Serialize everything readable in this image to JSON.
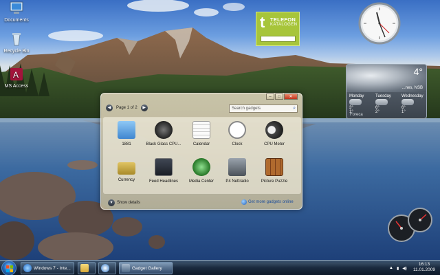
{
  "desktop": {
    "icons": [
      {
        "label": "Documents",
        "icon": "computer-icon"
      },
      {
        "label": "Recycle Bin",
        "icon": "recycle-bin-icon"
      },
      {
        "label": "MS Access",
        "icon": "ms-access-icon"
      }
    ]
  },
  "telefon_gadget": {
    "line1": "TELEFON",
    "line2": "KATALOGEN",
    "letter": "t",
    "search_value": ""
  },
  "weather_gadget": {
    "temp": "4°",
    "location": "...nes, NSB",
    "days": [
      {
        "name": "Monday",
        "hi": "3°",
        "lo": "1°"
      },
      {
        "name": "Tuesday",
        "hi": "6°",
        "lo": "2°"
      },
      {
        "name": "Wednesday",
        "hi": "6°",
        "lo": "1°"
      }
    ],
    "source": "Foreca"
  },
  "gadget_gallery": {
    "page_label": "Page 1 of 2",
    "search_placeholder": "Search gadgets",
    "show_details": "Show details",
    "get_more": "Get more gadgets online",
    "items": [
      {
        "name": "1881",
        "icon": "1881-icon",
        "color": "#5aa0e0"
      },
      {
        "name": "Black Glass CPU...",
        "icon": "cpu-meter-icon",
        "color": "#2b2b2b"
      },
      {
        "name": "Calendar",
        "icon": "calendar-icon",
        "color": "#f4f4f4"
      },
      {
        "name": "Clock",
        "icon": "clock-icon",
        "color": "#ffffff"
      },
      {
        "name": "CPU Meter",
        "icon": "cpu-gauge-icon",
        "color": "#444444"
      },
      {
        "name": "Currency",
        "icon": "currency-icon",
        "color": "#c9a73d"
      },
      {
        "name": "Feed Headlines",
        "icon": "feed-icon",
        "color": "#2a2f38"
      },
      {
        "name": "Media Center",
        "icon": "media-center-icon",
        "color": "#3b8d3b"
      },
      {
        "name": "P4 Nettradio",
        "icon": "radio-icon",
        "color": "#555555"
      },
      {
        "name": "Picture Puzzle",
        "icon": "puzzle-icon",
        "color": "#9a5a2a"
      }
    ]
  },
  "taskbar": {
    "buttons": [
      {
        "label": "Windows 7 - Inte...",
        "icon": "ie-icon"
      },
      {
        "label": "",
        "icon": "folder-icon"
      },
      {
        "label": "",
        "icon": "media-player-icon"
      },
      {
        "label": "Gadget Gallery",
        "icon": "gadget-gallery-icon"
      }
    ],
    "clock_time": "16:13",
    "clock_date": "11.01.2009"
  },
  "colors": {
    "accent": "#a7c53a",
    "taskbar": "#14243a"
  }
}
